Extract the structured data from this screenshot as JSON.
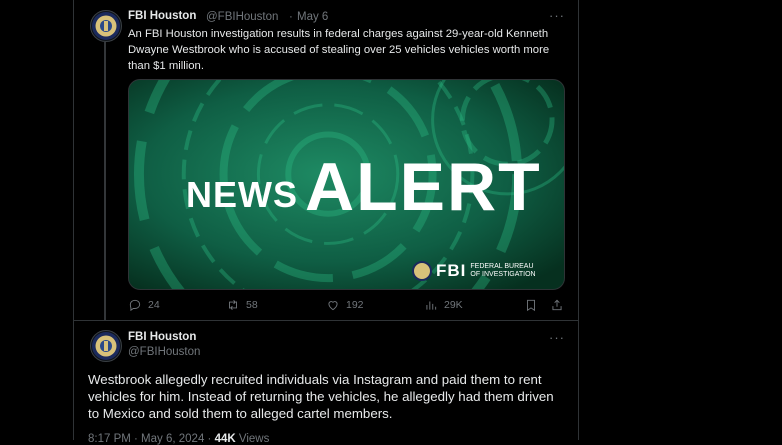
{
  "tweet1": {
    "name": "FBI Houston",
    "handle": "@FBIHouston",
    "sep": "·",
    "date": "May 6",
    "more": "···",
    "text": "An FBI Houston investigation results in federal charges against 29-year-old Kenneth Dwayne Westbrook who is accused of stealing over 25 vehicles vehicles worth more than $1 million.",
    "media": {
      "word1": "NEWS",
      "word2": "ALERT",
      "logo_text": "FBI",
      "logo_sub": "FEDERAL BUREAU OF INVESTIGATION"
    },
    "actions": {
      "replies": "24",
      "reposts": "58",
      "likes": "192",
      "views": "29K"
    }
  },
  "tweet2": {
    "name": "FBI Houston",
    "handle": "@FBIHouston",
    "text": "Westbrook allegedly recruited individuals via Instagram and paid them to rent vehicles for him. Instead of returning the vehicles, he allegedly had them driven to Mexico and sold them to alleged cartel members.",
    "meta_time": "8:17 PM · May 6, 2024 ·",
    "meta_views": "44K",
    "meta_views_label": "Views"
  },
  "colors": {
    "accent_bg": "#0c4a36",
    "muted": "#71767b",
    "text": "#e7e9ea"
  }
}
